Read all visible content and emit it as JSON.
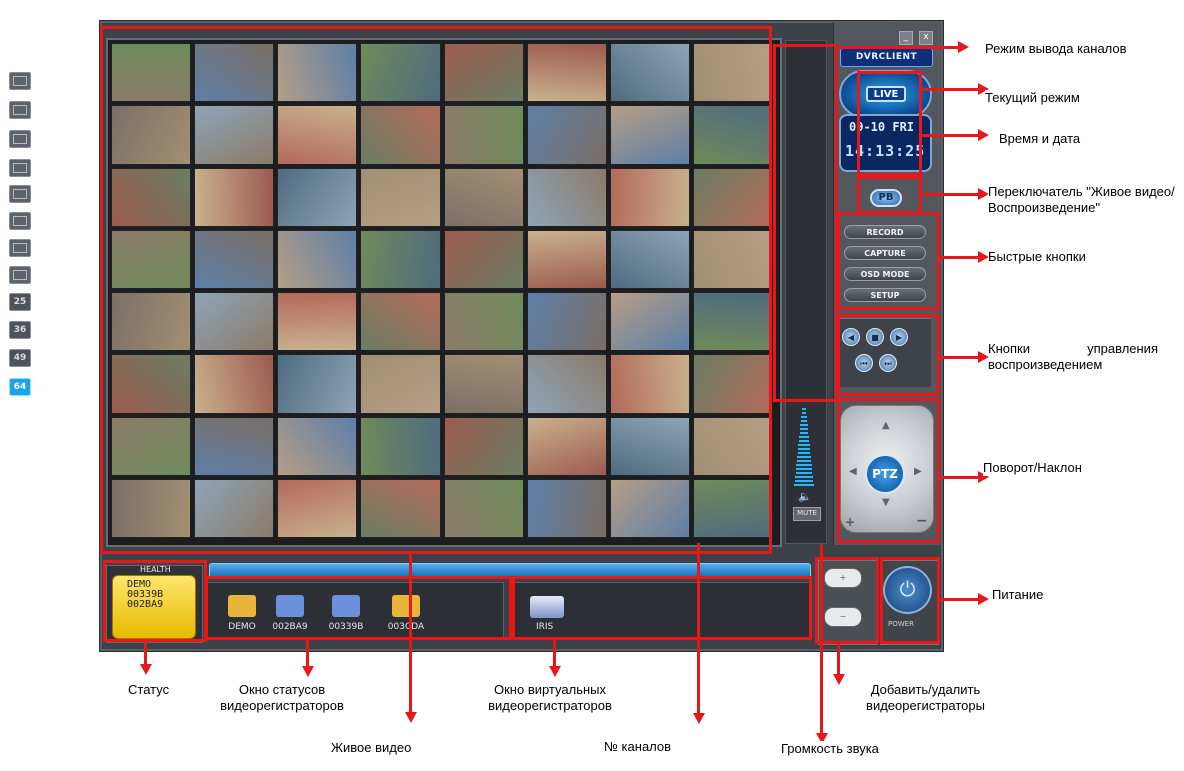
{
  "window": {
    "minimize_icon": "minimize-icon",
    "close_icon": "close-icon",
    "close_glyph": "x",
    "minimize_glyph": "_"
  },
  "panel": {
    "logo": "DVRCLIENT",
    "mode_badge": "LIVE",
    "date": "09-10 FRI",
    "time": "14:13:25",
    "pb_button": "PB",
    "quick_buttons": [
      "RECORD",
      "CAPTURE",
      "OSD MODE",
      "SETUP"
    ],
    "ptz_button": "PTZ",
    "zoom_plus": "+",
    "zoom_minus": "−",
    "mute_label": "MUTE"
  },
  "layouts": {
    "numbered": [
      "25",
      "36",
      "49",
      "64"
    ],
    "active": "64"
  },
  "bottom": {
    "health_label": "HEALTH",
    "health_text": "DEMO\n00339B\n002BA9",
    "dvrs": [
      {
        "label": "DEMO",
        "color": "#e8b73a"
      },
      {
        "label": "002BA9",
        "color": "#6b8fd8"
      },
      {
        "label": "00339B",
        "color": "#6b8fd8"
      },
      {
        "label": "003CDA",
        "color": "#e8b73a"
      }
    ],
    "virtual_dvr": "IRIS",
    "power_label": "POWER"
  },
  "annotations": {
    "channel_mode": "Режим вывода каналов",
    "current_mode": "Текущий режим",
    "time_date": "Время и дата",
    "switch": "Переключатель \"Живое видео/Воспроизведение\"",
    "quick_buttons": "Быстрые кнопки",
    "playback_controls": "Кнопки управления воспроизведением",
    "pan_tilt": "Поворот/Наклон",
    "power": "Питание",
    "status": "Статус",
    "dvr_status_window": "Окно статусов видеорегистраторов",
    "virtual_dvr_window": "Окно виртуальных видеорегистраторов",
    "add_remove": "Добавить/удалить видеорегистраторы",
    "live_video": "Живое видео",
    "channel_no": "№ каналов",
    "volume": "Громкость звука"
  },
  "colors": {
    "accent_red": "#e8171a",
    "live_blue": "#1aa3e8",
    "health_yellow": "#f2cd2a"
  }
}
